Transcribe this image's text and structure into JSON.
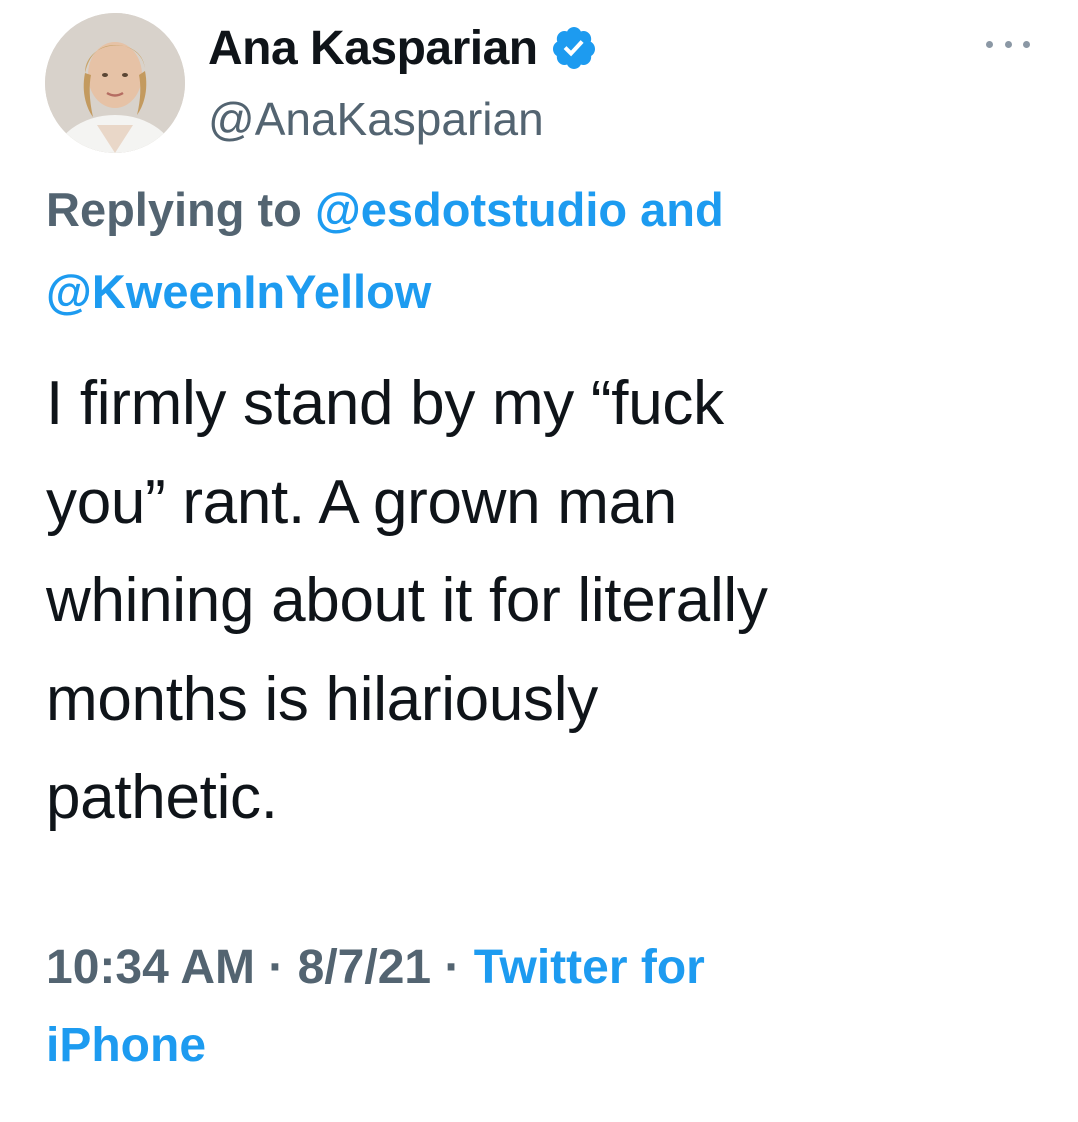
{
  "author": {
    "display_name": "Ana Kasparian",
    "handle": "@AnaKasparian",
    "avatar_icon": "profile-photo",
    "verified_icon": "verified-badge-icon"
  },
  "menu": {
    "more_icon": "more-dots-icon"
  },
  "reply": {
    "prefix": "Replying to",
    "mention_1": "@esdotstudio",
    "conjunction": "and",
    "mention_2": "@KweenInYellow"
  },
  "tweet": {
    "lines": [
      "I firmly stand by my “fuck",
      "you” rant. A grown man",
      "whining about it for literally",
      "months is hilariously",
      "pathetic."
    ]
  },
  "meta": {
    "time": "10:34 AM",
    "separator": " · ",
    "date": "8/7/21",
    "source_part_1": "Twitter for",
    "source_part_2": "iPhone"
  },
  "colors": {
    "text": "#0f1419",
    "muted": "#536471",
    "link": "#1d9bf0",
    "verified": "#1d9bf0"
  }
}
